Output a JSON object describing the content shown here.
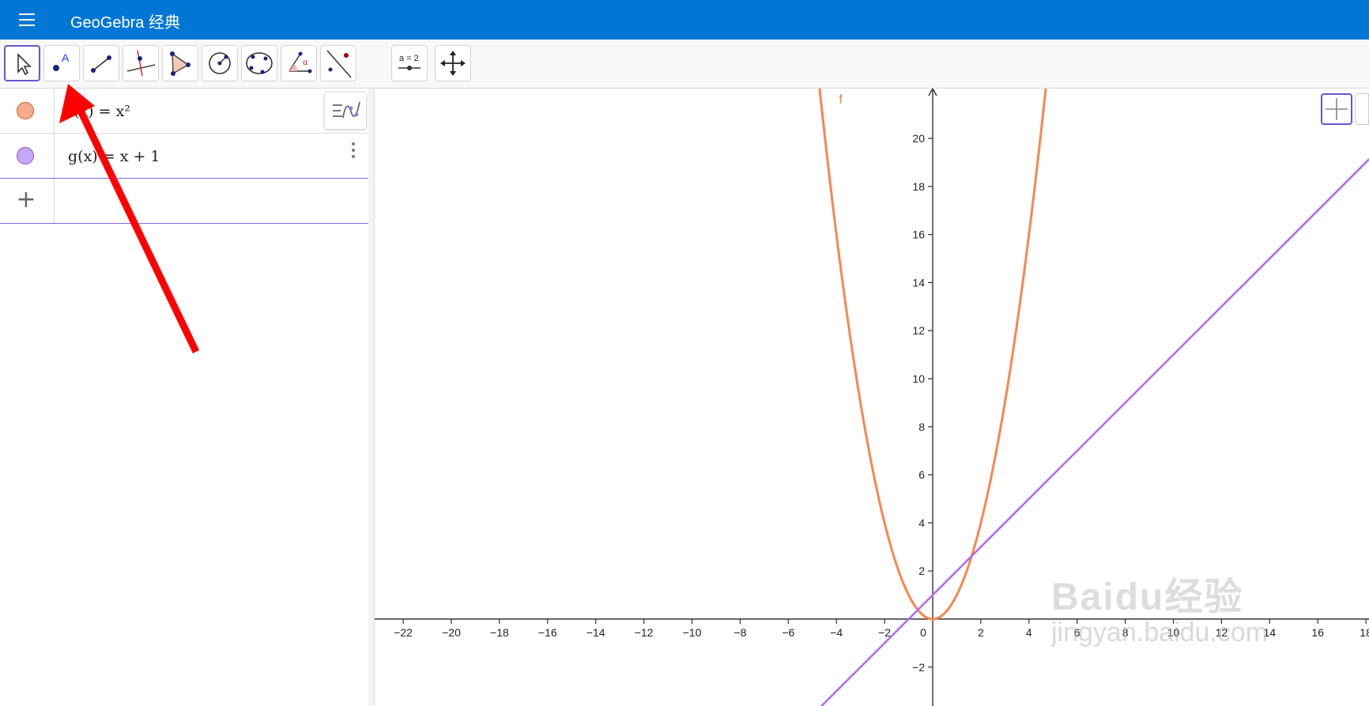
{
  "app": {
    "title": "GeoGebra 经典"
  },
  "toolbar": {
    "tools": [
      {
        "name": "move-tool",
        "active": true
      },
      {
        "name": "point-tool",
        "label": "A"
      },
      {
        "name": "segment-tool"
      },
      {
        "name": "perpendicular-line-tool"
      },
      {
        "name": "polygon-tool"
      },
      {
        "name": "circle-center-point-tool"
      },
      {
        "name": "conic-five-points-tool"
      },
      {
        "name": "angle-tool",
        "label": "α"
      },
      {
        "name": "reflect-tool"
      },
      {
        "name": "slider-tool",
        "label": "a = 2"
      },
      {
        "name": "move-graphics-view-tool"
      }
    ]
  },
  "algebra": {
    "rows": [
      {
        "label": "f(x) = x²",
        "color": "#f7ab8c",
        "border": "#c0602a"
      },
      {
        "label": "g(x) = x + 1",
        "color": "#c6a7f5",
        "border": "#8a4fd6"
      }
    ],
    "input_placeholder": ""
  },
  "graph": {
    "function_label": "f",
    "f_color": "#f7864f",
    "g_color": "#b26cf0",
    "x_ticks": [
      -22,
      -20,
      -18,
      -16,
      -14,
      -12,
      -10,
      -8,
      -6,
      -4,
      -2,
      0,
      2,
      4,
      6,
      8,
      10,
      12,
      14,
      16,
      18
    ],
    "y_ticks": [
      -2,
      2,
      4,
      6,
      8,
      10,
      12,
      14,
      16,
      18,
      20
    ]
  },
  "watermark": {
    "logo": "Baidu经验",
    "url": "jingyan.baidu.com"
  },
  "colors": {
    "header": "#0176d5",
    "accent": "#6557d2",
    "arrow": "#ff0000"
  }
}
